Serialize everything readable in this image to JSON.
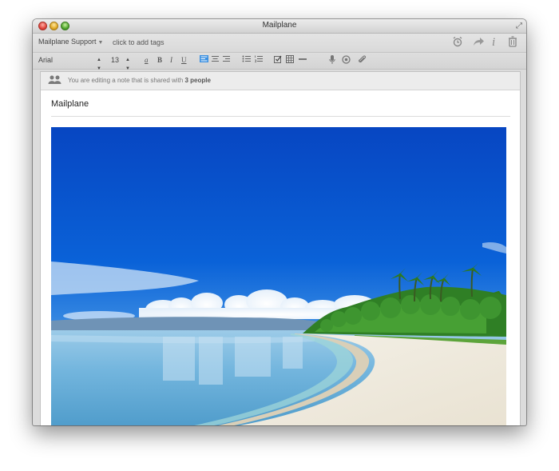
{
  "window": {
    "title": "Mailplane"
  },
  "toolbar": {
    "account": "Mailplane Support",
    "tags_placeholder": "click to add tags"
  },
  "format": {
    "font": "Arial",
    "size": "13",
    "font_color_label": "a",
    "bold": "B",
    "italic": "I",
    "underline": "U"
  },
  "sharing": {
    "prefix": "You are editing a note that is shared with",
    "count": "3 people"
  },
  "note": {
    "title": "Mailplane"
  },
  "colors": {
    "sky": "#0a52cc",
    "sea": "#6fb6de",
    "sand": "#f3efe4",
    "foliage": "#3a8a2a",
    "align_active": "#3a8fe0"
  }
}
